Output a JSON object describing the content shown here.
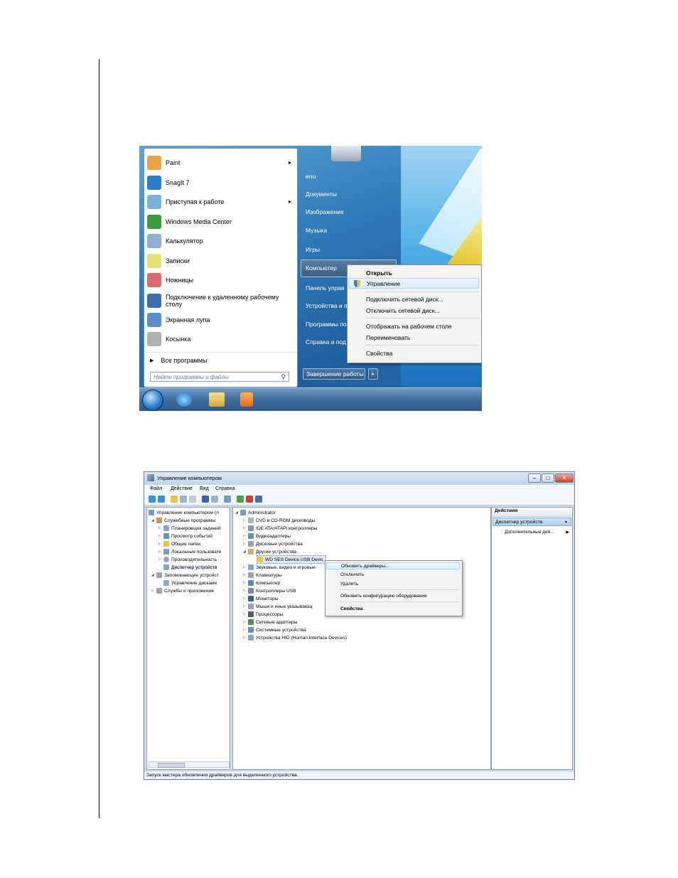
{
  "start_menu": {
    "programs": [
      {
        "label": "Paint",
        "arrow": "▸",
        "icon": "paint-icon",
        "color": "#e9a441"
      },
      {
        "label": "SnagIt 7",
        "arrow": "",
        "icon": "snagit-icon",
        "color": "#2b7fc8"
      },
      {
        "label": "Приступая к работе",
        "arrow": "▸",
        "icon": "getting-started-icon",
        "color": "#7ab4de"
      },
      {
        "label": "Windows Media Center",
        "arrow": "",
        "icon": "media-center-icon",
        "color": "#3c9b3a"
      },
      {
        "label": "Калькулятор",
        "arrow": "",
        "icon": "calculator-icon",
        "color": "#8fb0d2"
      },
      {
        "label": "Записки",
        "arrow": "",
        "icon": "sticky-notes-icon",
        "color": "#e8e070"
      },
      {
        "label": "Ножницы",
        "arrow": "",
        "icon": "scissors-icon",
        "color": "#d86a6a"
      },
      {
        "label": "Подключение к удаленному рабочему столу",
        "arrow": "",
        "icon": "remote-desktop-icon",
        "color": "#3d6fb0"
      },
      {
        "label": "Экранная лупа",
        "arrow": "",
        "icon": "magnifier-icon",
        "color": "#5a8fc8"
      },
      {
        "label": "Косынка",
        "arrow": "",
        "icon": "solitaire-icon",
        "color": "#b0b0b0"
      }
    ],
    "all_programs": "Все программы",
    "all_programs_arrow": "▶",
    "search_placeholder": "Найти программы и файлы",
    "right_items": [
      "enu",
      "Документы",
      "Изображения",
      "Музыка",
      "Игры",
      "Компьютер",
      "Панель управ",
      "Устройства и п",
      "Программы по",
      "Справка и под"
    ],
    "shutdown": "Завершение работы",
    "shutdown_arrow": "▸"
  },
  "context_menu_1": {
    "items": [
      {
        "label": "Открыть",
        "bold": true
      },
      {
        "label": "Управление",
        "highlighted": true
      },
      {
        "label": "Подключить сетевой диск..."
      },
      {
        "label": "Отключить сетевой диск..."
      },
      {
        "label": "Отображать на рабочем столе"
      },
      {
        "label": "Переименовать"
      },
      {
        "label": "Свойства"
      }
    ]
  },
  "mmc": {
    "title": "Управление компьютером",
    "window_buttons": [
      "–",
      "□",
      "✕"
    ],
    "menu": [
      "Файл",
      "Действие",
      "Вид",
      "Справка"
    ],
    "left_tree": [
      "Управление компьютером (л",
      "Служебные программы",
      "Планировщик заданий",
      "Просмотр событий",
      "Общие папки",
      "Локальные пользовате",
      "Производительность",
      "Диспетчер устройств",
      "Запоминающие устройст",
      "Управление дисками",
      "Службы и приложения"
    ],
    "device_tree": [
      "Administrator",
      "DVD и CD-ROM дисководы",
      "IDE ATA/ATAPI контроллеры",
      "Видеоадаптеры",
      "Дисковые устройства",
      "Другие устройства",
      "WD SES Device USB Devic",
      "Звуковые, видео и игровые",
      "Клавиатуры",
      "Компьютер",
      "Контроллеры USB",
      "Мониторы",
      "Мыши и иные указывающ",
      "Процессоры",
      "Сетевые адаптеры",
      "Системные устройства",
      "Устройства HID (Human Interface Devices)"
    ],
    "actions_header": "Действия",
    "actions_selected": "Диспетчер устройств",
    "actions_more": "Дополнительные дей...",
    "status": "Запуск мастера обновления драйверов для выделенного устройства."
  },
  "context_menu_2": {
    "items": [
      {
        "label": "Обновить драйверы...",
        "highlighted": true
      },
      {
        "label": "Отключить"
      },
      {
        "label": "Удалить"
      },
      {
        "label": "Обновить конфигурацию оборудования"
      },
      {
        "label": "Свойства",
        "bold": true
      }
    ]
  }
}
